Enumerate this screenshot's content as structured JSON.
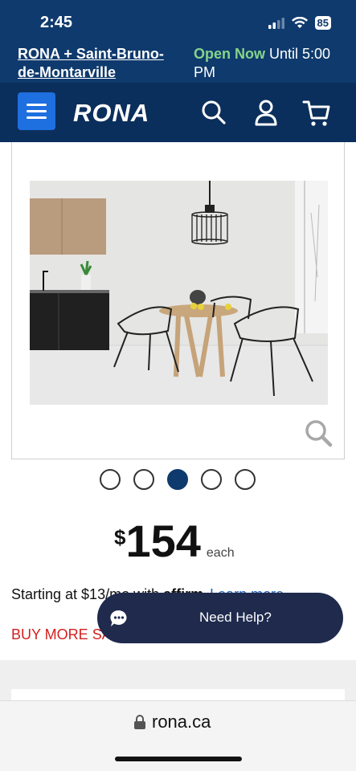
{
  "status_bar": {
    "time": "2:45",
    "battery": "85"
  },
  "store": {
    "name": "RONA + Saint-Bruno-de-Montarville",
    "open_label": "Open Now",
    "hours": "Until 5:00 PM"
  },
  "nav": {
    "logo": "RONA",
    "icons": [
      "menu-icon",
      "search-icon",
      "account-icon",
      "cart-icon"
    ]
  },
  "gallery": {
    "total": 5,
    "active_index": 2
  },
  "price": {
    "currency": "$",
    "amount": "154",
    "unit": "each"
  },
  "financing": {
    "prefix": "Starting at $13/mo with ",
    "brand": "affirm",
    "link": "Learn more"
  },
  "promo": {
    "text": "BUY MORE SAVE MORE"
  },
  "help": {
    "label": "Need Help?"
  },
  "browser": {
    "url": "rona.ca"
  },
  "colors": {
    "brand_navy": "#0f3a6d",
    "menu_blue": "#1e6fe0",
    "promo_red": "#d41f1f",
    "help_bg": "#1f2a4d"
  }
}
